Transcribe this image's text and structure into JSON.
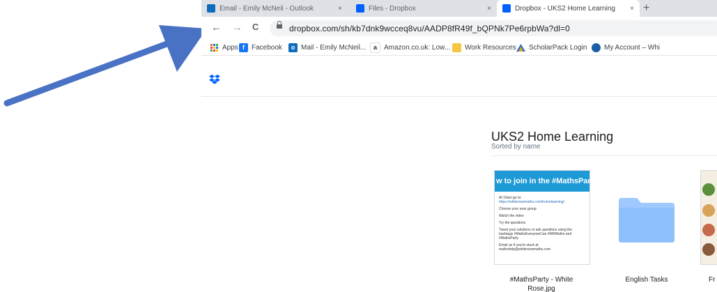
{
  "browser": {
    "tabs": [
      {
        "label": "Email - Emily McNeil - Outlook",
        "active": false
      },
      {
        "label": "Files - Dropbox",
        "active": false
      },
      {
        "label": "Dropbox - UKS2 Home Learning",
        "active": true
      }
    ],
    "tab_close": "×",
    "new_tab": "+",
    "url": "dropbox.com/sh/kb7dnk9wcceq8vu/AADP8fR49f_bQPNk7Pe6rpbWa?dl=0",
    "nav": {
      "back": "←",
      "forward": "→",
      "reload": "C"
    }
  },
  "bookmarks": [
    {
      "label": "Apps",
      "icon": "apps-grid-icon"
    },
    {
      "label": "Facebook",
      "icon": "facebook-icon"
    },
    {
      "label": "Mail - Emily McNeil...",
      "icon": "outlook-icon"
    },
    {
      "label": "Amazon.co.uk: Low...",
      "icon": "amazon-icon"
    },
    {
      "label": "Work Resources",
      "icon": "folder-icon"
    },
    {
      "label": "ScholarPack Login",
      "icon": "scholarpack-icon"
    },
    {
      "label": "My Account – Whi",
      "icon": "account-icon"
    }
  ],
  "page": {
    "title": "UKS2 Home Learning",
    "sorted_by": "Sorted by name"
  },
  "thumbnail": {
    "banner": "w to join in the #MathsParty",
    "lines": [
      "At 10am go to:",
      "https://whiterosemaths.com/homelearning/",
      "Choose your year group",
      "Watch the video",
      "Try the questions",
      "Tweet your solutions or ask questions using the hashtags #MathsEveryoneCan #WRMaths and #MathsParty",
      "Email us if you're stuck at mathshelp@whiterosemaths.com"
    ]
  },
  "files": [
    {
      "name": "#MathsParty - White Rose.jpg",
      "kind": "image"
    },
    {
      "name": "English Tasks",
      "kind": "folder"
    },
    {
      "name": "Fr",
      "kind": "image"
    }
  ],
  "colors": {
    "arrow": "#4a72c4",
    "dropbox_blue": "#0061fe",
    "folder": "#9fc9ff"
  }
}
